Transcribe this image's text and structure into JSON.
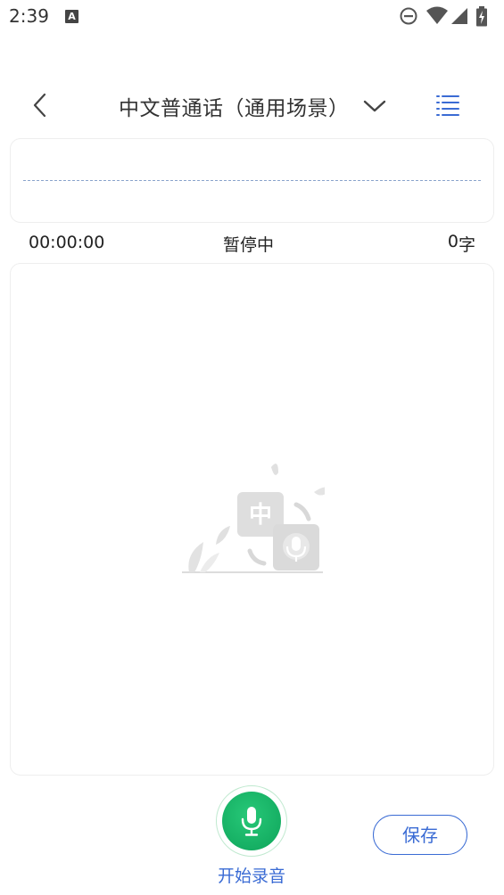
{
  "status_bar": {
    "time": "2:39",
    "notification_icon": "A",
    "icons": [
      "do-not-disturb-icon",
      "wifi-icon",
      "signal-icon",
      "battery-charging-icon"
    ]
  },
  "header": {
    "back_icon": "chevron-left-icon",
    "title": "中文普通话（通用场景）",
    "dropdown_icon": "chevron-down-icon",
    "menu_icon": "list-icon"
  },
  "waveform": {
    "line_color": "#8aa3cc"
  },
  "info": {
    "elapsed_time": "00:00:00",
    "status": "暂停中",
    "char_count": "0",
    "char_unit": "字"
  },
  "transcript": {
    "text": "",
    "empty_state_icon": "speech-to-text-illustration",
    "empty_state_badge": "中"
  },
  "controls": {
    "record_label": "开始录音",
    "record_icon": "microphone-icon",
    "save_label": "保存"
  },
  "colors": {
    "accent_blue": "#3a6bd4",
    "record_green": "#1bb865",
    "text": "#333333"
  }
}
